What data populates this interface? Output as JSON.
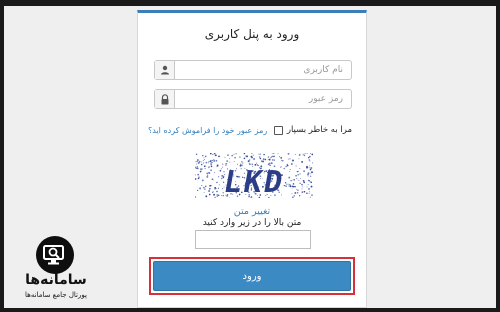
{
  "login_card": {
    "title": "ورود به پنل کاربری",
    "username_placeholder": "نام کاربری",
    "password_placeholder": "رمز عبور",
    "remember_me_label": "مرا به خاطر بسپار",
    "forgot_password_link": "رمز عبور خود را فراموش کرده اید؟",
    "captcha_text": "LKD",
    "change_captcha_link": "تغییر متن",
    "captcha_instruction": "متن بالا را در زیر وارد کنید",
    "captcha_input_value": "",
    "login_button_label": "ورود",
    "accent_color": "#3b7fb6",
    "highlight_color": "#d6313b"
  },
  "watermark": {
    "name": "سامانه‌ها",
    "tagline": "پورتال جامع سامانه‌ها",
    "icon": "magnifier-screen-icon"
  }
}
